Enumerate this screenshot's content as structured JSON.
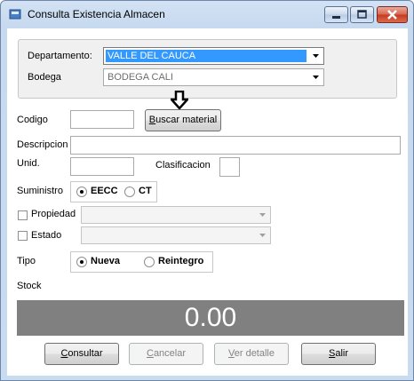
{
  "window": {
    "title": "Consulta Existencia Almacen"
  },
  "filters": {
    "departamento_label": "Departamento:",
    "departamento_value": "VALLE DEL CAUCA",
    "bodega_label": "Bodega",
    "bodega_value": "BODEGA CALI"
  },
  "form": {
    "codigo_label": "Codigo",
    "codigo_value": "",
    "buscar_button_prefix": "B",
    "buscar_button_rest": "uscar material",
    "descripcion_label": "Descripcion",
    "descripcion_value": "",
    "unid_label": "Unid.",
    "unid_value": "",
    "clasificacion_label": "Clasificacion",
    "clasificacion_value": "",
    "suministro_label": "Suministro",
    "suministro_options": [
      "EECC",
      "CT"
    ],
    "suministro_selected": "EECC",
    "propiedad_label": "Propiedad",
    "propiedad_checked": false,
    "estado_label": "Estado",
    "estado_checked": false,
    "tipo_label": "Tipo",
    "tipo_options": [
      "Nueva",
      "Reintegro"
    ],
    "tipo_selected": "Nueva",
    "stock_label": "Stock",
    "stock_value": "0.00"
  },
  "buttons": {
    "consultar_prefix": "C",
    "consultar_rest": "onsultar",
    "cancelar_prefix": "C",
    "cancelar_rest": "ancelar",
    "ver_detalle_prefix": "V",
    "ver_detalle_rest": "er detalle",
    "salir_prefix": "S",
    "salir_rest": "alir"
  },
  "colors": {
    "selection": "#3399ff",
    "stock_background": "#808080",
    "close_button": "#c7391d"
  }
}
